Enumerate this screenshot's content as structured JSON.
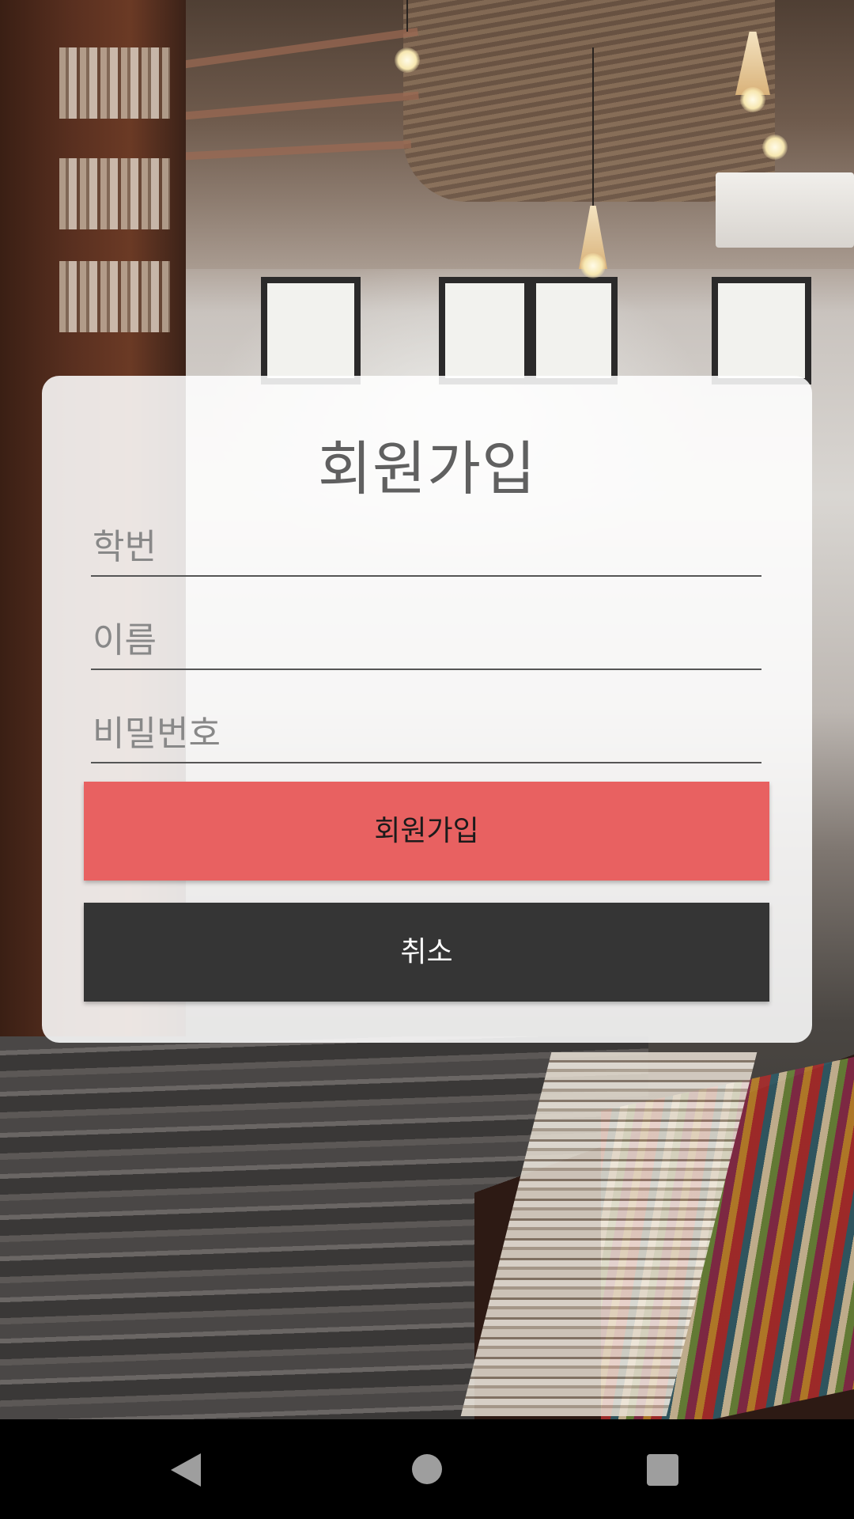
{
  "signup_form": {
    "title": "회원가입",
    "student_id_placeholder": "학번",
    "name_placeholder": "이름",
    "password_placeholder": "비밀번호",
    "signup_button_label": "회원가입",
    "cancel_button_label": "취소"
  },
  "colors": {
    "signup_button": "#e86161",
    "cancel_button": "#353535",
    "card_background": "rgba(255,255,255,0.87)"
  },
  "navigation_bar": {
    "icons": [
      "back-icon",
      "home-icon",
      "recent-apps-icon"
    ]
  }
}
